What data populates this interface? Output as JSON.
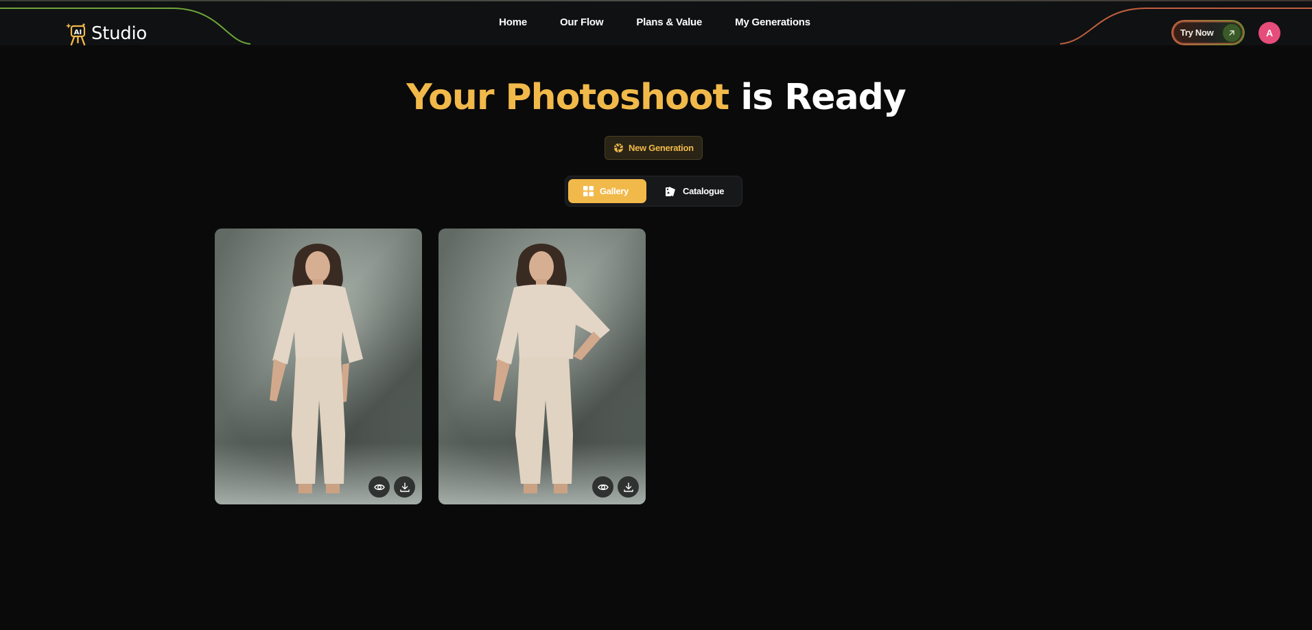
{
  "brand": {
    "logo_badge": "AI",
    "name": "Studio",
    "accent_color": "#f1b94a"
  },
  "nav": {
    "items": [
      {
        "label": "Home"
      },
      {
        "label": "Our Flow"
      },
      {
        "label": "Plans & Value"
      },
      {
        "label": "My Generations"
      }
    ]
  },
  "header_actions": {
    "try_now_label": "Try Now",
    "try_now_icon": "arrow-up-right-icon",
    "avatar_initial": "A",
    "avatar_color": "#e64d7a"
  },
  "hero": {
    "title_accent": "Your Photoshoot",
    "title_rest": "is Ready",
    "new_generation_label": "New Generation",
    "new_generation_icon": "aperture-icon"
  },
  "view_toggle": {
    "options": [
      {
        "label": "Gallery",
        "icon": "grid-icon",
        "active": true
      },
      {
        "label": "Catalogue",
        "icon": "catalogue-icon",
        "active": false
      }
    ]
  },
  "gallery": {
    "images": [
      {
        "actions": [
          "eye-icon",
          "download-icon"
        ]
      },
      {
        "actions": [
          "eye-icon",
          "download-icon"
        ]
      }
    ]
  }
}
